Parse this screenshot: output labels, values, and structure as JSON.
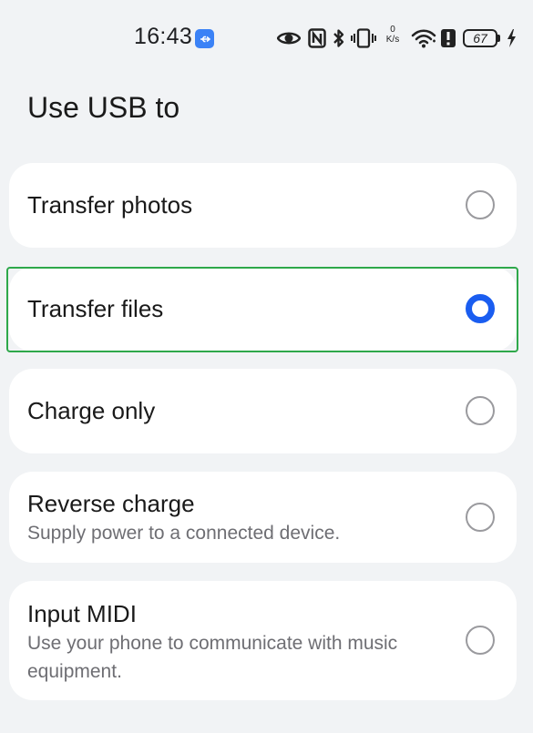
{
  "status_bar": {
    "time": "16:43",
    "net_speed_value": "0",
    "net_speed_unit": "K/s",
    "battery": "67",
    "icons": [
      "usb-icon",
      "eye-icon",
      "nfc-icon",
      "bluetooth-icon",
      "vibrate-icon",
      "wifi-icon",
      "battery-alert-icon",
      "charging-icon"
    ]
  },
  "page": {
    "title": "Use USB to"
  },
  "options": [
    {
      "label": "Transfer photos",
      "selected": false
    },
    {
      "label": "Transfer files",
      "selected": true
    },
    {
      "label": "Charge only",
      "selected": false
    },
    {
      "label": "Reverse charge",
      "description": "Supply power to a connected device.",
      "selected": false
    },
    {
      "label": "Input MIDI",
      "description": "Use your phone to communicate with music equipment.",
      "selected": false
    }
  ],
  "colors": {
    "background": "#f1f3f5",
    "card": "#ffffff",
    "accent": "#1a5df0",
    "highlight_border": "#2ea84a"
  }
}
